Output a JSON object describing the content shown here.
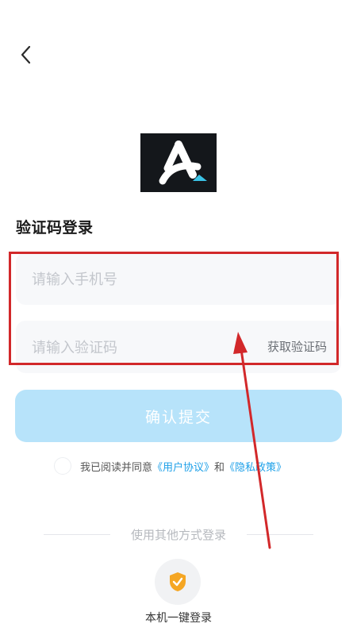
{
  "header": {
    "back_icon": "chevron-left-icon"
  },
  "logo": {
    "icon": "letter-a-logo",
    "bg_color": "#14171b",
    "accent_color": "#3bc3e6"
  },
  "title": "验证码登录",
  "phone_field": {
    "placeholder": "请输入手机号",
    "value": ""
  },
  "code_field": {
    "placeholder": "请输入验证码",
    "value": "",
    "get_code_label": "获取验证码"
  },
  "submit": {
    "label": "确认提交",
    "color": "#b7e3fa"
  },
  "agreement": {
    "prefix": "我已阅读并同意",
    "user_agreement": "《用户协议》",
    "and": "和",
    "privacy_policy": "《隐私政策》",
    "checked": false,
    "link_color": "#1ea0e8"
  },
  "other_login": {
    "divider_text": "使用其他方式登录",
    "one_click_label": "本机一键登录",
    "one_click_icon": "shield-check-icon",
    "icon_color": "#f5a623"
  },
  "annotation": {
    "box_color": "#d2282a",
    "arrow_color": "#d2282a"
  }
}
